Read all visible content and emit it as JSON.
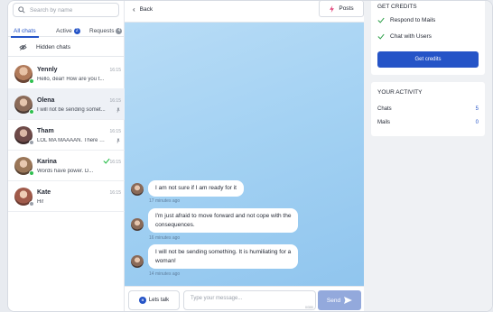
{
  "search": {
    "placeholder": "Search by name"
  },
  "tabs": [
    {
      "label": "All chats"
    },
    {
      "label": "Active",
      "count": "2"
    },
    {
      "label": "Requests",
      "count": "4"
    }
  ],
  "hidden_chats": {
    "label": "Hidden chats"
  },
  "chats": [
    {
      "name": "Yennly",
      "message": "Hello, dear! How are you t...",
      "time": "16:15",
      "online": true,
      "avatar_color": "#b07a5a"
    },
    {
      "name": "Olena",
      "message": "I will not be sending somet...",
      "time": "16:15",
      "online": true,
      "avatar_color": "#8a6a58"
    },
    {
      "name": "Tham",
      "message": "LOL MA MAAAAN. There w...",
      "time": "16:15",
      "online": false,
      "avatar_color": "#6e4a48"
    },
    {
      "name": "Karina",
      "message": "Words have power. D...",
      "time": "16:15",
      "online": true,
      "avatar_color": "#9a7658"
    },
    {
      "name": "Kate",
      "message": "Hi!",
      "time": "16:15",
      "online": false,
      "avatar_color": "#a05a4a"
    }
  ],
  "topbar": {
    "back_label": "Back",
    "posts_label": "Posts"
  },
  "messages": [
    {
      "text_lines": [
        "I am not sure if I am ready for it"
      ],
      "ago": "17 minutes ago"
    },
    {
      "text_lines": [
        "I'm just afraid to move forward and not cope with the",
        "consequences."
      ],
      "ago": "16 minutes ago"
    },
    {
      "text_lines": [
        "I will not be sending something. It is humiliating for a",
        "woman!"
      ],
      "ago": "14 minutes ago"
    }
  ],
  "composer": {
    "lets_talk_label": "Lets talk",
    "lets_talk_icon": "lt",
    "placeholder": "Type your message...",
    "counter": "0/300",
    "send_label": "Send"
  },
  "credits_card": {
    "title": "GET CREDITS",
    "items": [
      "Respond to Mails",
      "Chat with Users"
    ],
    "button_label": "Get credits"
  },
  "activity_card": {
    "title": "YOUR ACTIVITY",
    "rows": [
      {
        "label": "Chats",
        "value": "5"
      },
      {
        "label": "Mails",
        "value": "0"
      }
    ]
  },
  "colors": {
    "accent": "#2554c7",
    "online": "#2fbf4f",
    "send_disabled": "#93a9dc"
  }
}
